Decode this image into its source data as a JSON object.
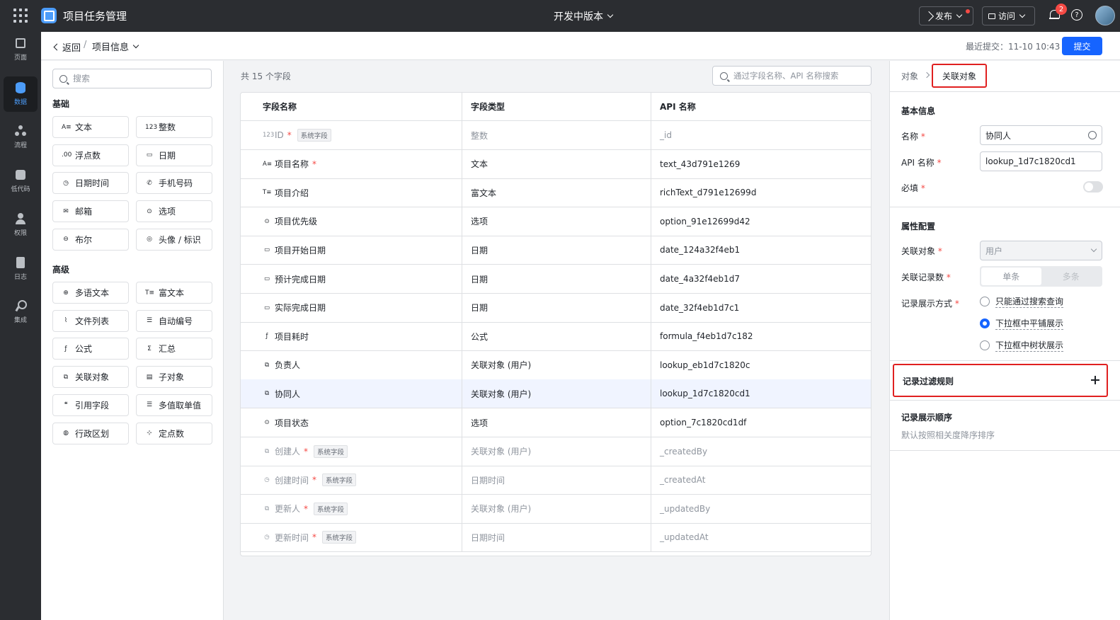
{
  "topbar": {
    "app_title": "项目任务管理",
    "version": "开发中版本",
    "publish": "发布",
    "visit": "访问",
    "notifications": "2"
  },
  "rail": [
    "页面",
    "数据",
    "流程",
    "低代码",
    "权限",
    "日志",
    "集成"
  ],
  "header": {
    "back": "返回",
    "sep": "/",
    "current": "项目信息",
    "last_submit": "最近提交：11-10 10:43",
    "submit": "提交"
  },
  "palette": {
    "search_placeholder": "搜索",
    "basic_title": "基础",
    "basic": [
      {
        "icon": "A≡",
        "label": "文本"
      },
      {
        "icon": "123",
        "label": "整数"
      },
      {
        "icon": ".00",
        "label": "浮点数"
      },
      {
        "icon": "▭",
        "label": "日期"
      },
      {
        "icon": "◷",
        "label": "日期时间"
      },
      {
        "icon": "✆",
        "label": "手机号码"
      },
      {
        "icon": "✉",
        "label": "邮箱"
      },
      {
        "icon": "⊙",
        "label": "选项"
      },
      {
        "icon": "⊖",
        "label": "布尔"
      },
      {
        "icon": "◎",
        "label": "头像 / 标识"
      }
    ],
    "advanced_title": "高级",
    "advanced": [
      {
        "icon": "⊕",
        "label": "多语文本"
      },
      {
        "icon": "T≡",
        "label": "富文本"
      },
      {
        "icon": "⌇",
        "label": "文件列表"
      },
      {
        "icon": "☰",
        "label": "自动编号"
      },
      {
        "icon": "ƒ",
        "label": "公式"
      },
      {
        "icon": "Σ",
        "label": "汇总"
      },
      {
        "icon": "⧉",
        "label": "关联对象"
      },
      {
        "icon": "▤",
        "label": "子对象"
      },
      {
        "icon": "❝",
        "label": "引用字段"
      },
      {
        "icon": "☰",
        "label": "多值取单值"
      },
      {
        "icon": "◍",
        "label": "行政区划"
      },
      {
        "icon": "⊹",
        "label": "定点数"
      }
    ]
  },
  "table": {
    "count": "共 15 个字段",
    "search_placeholder": "通过字段名称、API 名称搜索",
    "headers": [
      "字段名称",
      "字段类型",
      "API 名称"
    ],
    "system_tag": "系统字段",
    "rows": [
      {
        "icon": "123",
        "name": "ID",
        "required": "*",
        "system": true,
        "type": "整数",
        "api": "_id"
      },
      {
        "icon": "A≡",
        "name": "项目名称",
        "required": "*",
        "system": false,
        "type": "文本",
        "api": "text_43d791e1269"
      },
      {
        "icon": "T≡",
        "name": "项目介绍",
        "required": "",
        "system": false,
        "type": "富文本",
        "api": "richText_d791e12699d"
      },
      {
        "icon": "⊙",
        "name": "项目优先级",
        "required": "",
        "system": false,
        "type": "选项",
        "api": "option_91e12699d42"
      },
      {
        "icon": "▭",
        "name": "项目开始日期",
        "required": "",
        "system": false,
        "type": "日期",
        "api": "date_124a32f4eb1"
      },
      {
        "icon": "▭",
        "name": "预计完成日期",
        "required": "",
        "system": false,
        "type": "日期",
        "api": "date_4a32f4eb1d7"
      },
      {
        "icon": "▭",
        "name": "实际完成日期",
        "required": "",
        "system": false,
        "type": "日期",
        "api": "date_32f4eb1d7c1"
      },
      {
        "icon": "ƒ",
        "name": "项目耗时",
        "required": "",
        "system": false,
        "type": "公式",
        "api": "formula_f4eb1d7c182"
      },
      {
        "icon": "⧉",
        "name": "负责人",
        "required": "",
        "system": false,
        "type": "关联对象 (用户)",
        "api": "lookup_eb1d7c1820c"
      },
      {
        "icon": "⧉",
        "name": "协同人",
        "required": "",
        "system": false,
        "type": "关联对象 (用户)",
        "api": "lookup_1d7c1820cd1"
      },
      {
        "icon": "⊙",
        "name": "项目状态",
        "required": "",
        "system": false,
        "type": "选项",
        "api": "option_7c1820cd1df"
      },
      {
        "icon": "⧉",
        "name": "创建人",
        "required": "*",
        "system": true,
        "type": "关联对象 (用户)",
        "api": "_createdBy"
      },
      {
        "icon": "◷",
        "name": "创建时间",
        "required": "*",
        "system": true,
        "type": "日期时间",
        "api": "_createdAt"
      },
      {
        "icon": "⧉",
        "name": "更新人",
        "required": "*",
        "system": true,
        "type": "关联对象 (用户)",
        "api": "_updatedBy"
      },
      {
        "icon": "◷",
        "name": "更新时间",
        "required": "*",
        "system": true,
        "type": "日期时间",
        "api": "_updatedAt"
      }
    ]
  },
  "right": {
    "crumb_parent": "对象",
    "crumb_current": "关联对象",
    "basic_title": "基本信息",
    "name_label": "名称",
    "name_value": "协同人",
    "api_label": "API 名称",
    "api_value": "lookup_1d7c1820cd1",
    "required_label": "必填",
    "required_mark": "*",
    "attr_title": "属性配置",
    "lookup_label": "关联对象",
    "lookup_value": "用户",
    "count_label": "关联记录数",
    "count_single": "单条",
    "count_multi": "多条",
    "display_label": "记录展示方式",
    "display_options": [
      "只能通过搜索查询",
      "下拉框中平铺展示",
      "下拉框中树状展示"
    ],
    "filter_title": "记录过滤规则",
    "order_title": "记录展示顺序",
    "order_desc": "默认按照相关度降序排序"
  }
}
